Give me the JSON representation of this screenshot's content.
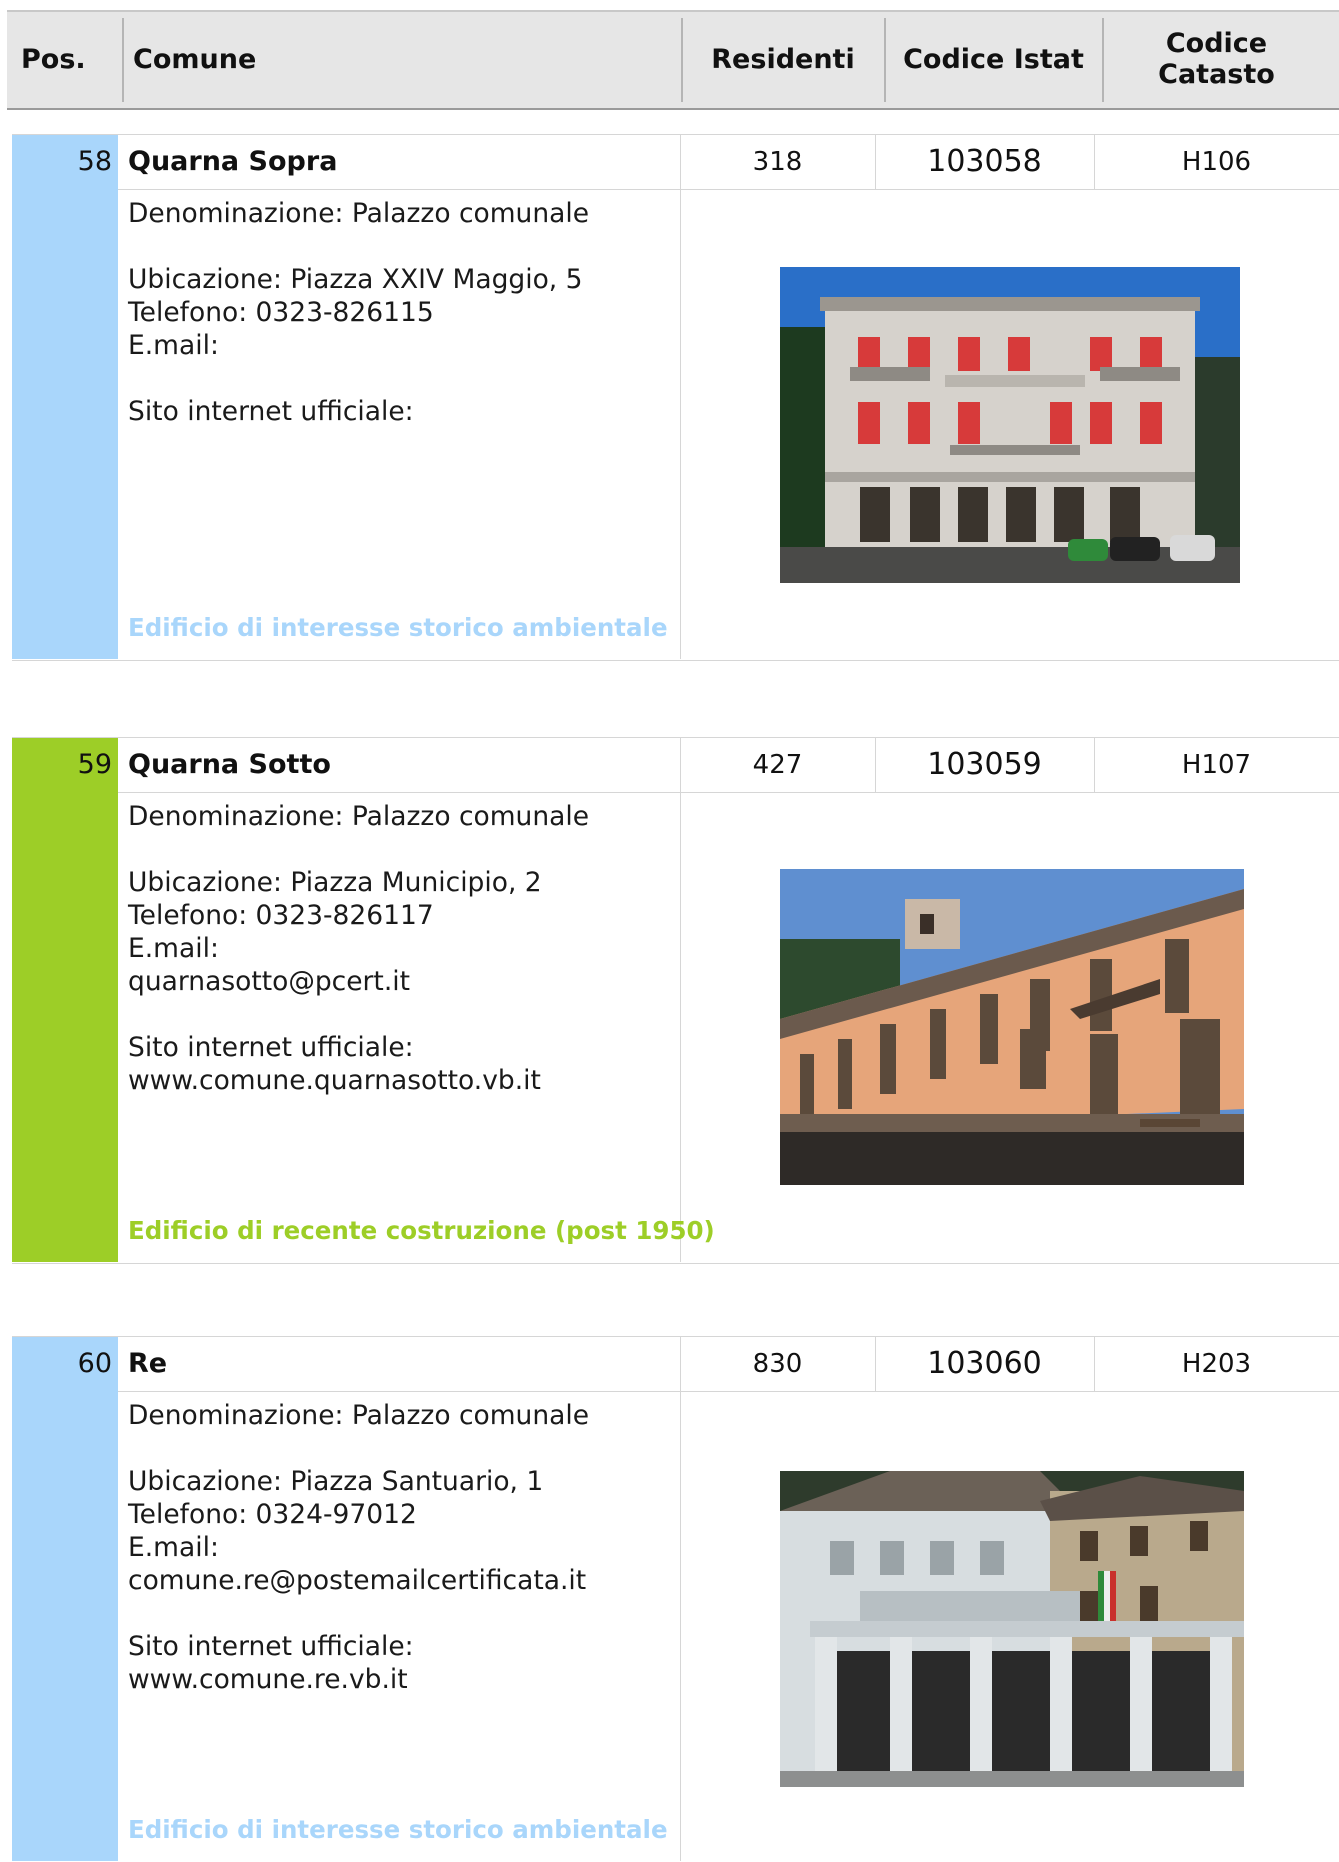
{
  "header": {
    "pos": "Pos.",
    "comune": "Comune",
    "residenti": "Residenti",
    "codice_istat": "Codice Istat",
    "codice_catasto_line1": "Codice",
    "codice_catasto_line2": "Catasto"
  },
  "colors": {
    "storico": "#a9d6fb",
    "recente": "#9dce27",
    "header_bg": "#e6e6e6"
  },
  "records": [
    {
      "pos": "58",
      "name": "Quarna Sopra",
      "residenti": "318",
      "istat": "103058",
      "catasto": "H106",
      "denominazione": "Denominazione: Palazzo comunale",
      "ubicazione": "Ubicazione: Piazza XXIV Maggio, 5",
      "telefono": "Telefono: 0323-826115",
      "email_label": "E.mail:",
      "email": "",
      "sito_label": "Sito internet ufficiale:",
      "sito": "",
      "categoria": "Edificio di interesse storico ambientale"
    },
    {
      "pos": "59",
      "name": "Quarna Sotto",
      "residenti": "427",
      "istat": "103059",
      "catasto": "H107",
      "denominazione": "Denominazione: Palazzo comunale",
      "ubicazione": "Ubicazione: Piazza Municipio, 2",
      "telefono": "Telefono: 0323-826117",
      "email_label": "E.mail:",
      "email": "quarnasotto@pcert.it",
      "sito_label": "Sito internet ufficiale:",
      "sito": "www.comune.quarnasotto.vb.it",
      "categoria": "Edificio di recente costruzione (post 1950)"
    },
    {
      "pos": "60",
      "name": "Re",
      "residenti": "830",
      "istat": "103060",
      "catasto": "H203",
      "denominazione": "Denominazione: Palazzo comunale",
      "ubicazione": "Ubicazione: Piazza Santuario, 1",
      "telefono": "Telefono: 0324-97012",
      "email_label": "E.mail:",
      "email": "comune.re@postemailcertificata.it",
      "sito_label": "Sito internet ufficiale:",
      "sito": "www.comune.re.vb.it",
      "categoria": "Edificio di interesse storico ambientale"
    }
  ]
}
